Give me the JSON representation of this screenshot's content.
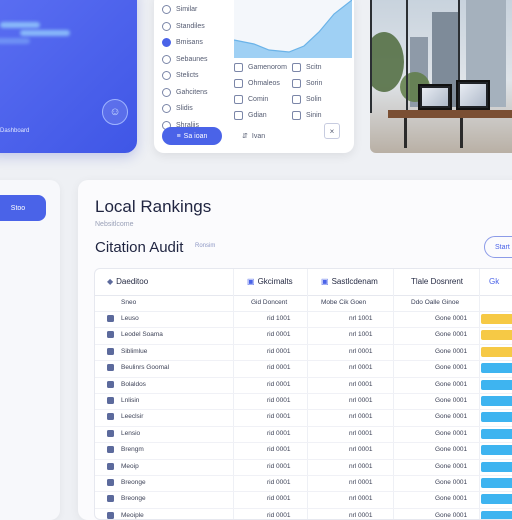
{
  "hero": {
    "label": "Dashboard",
    "avatar_icon": "user-icon"
  },
  "filters": {
    "items": [
      {
        "label": "Similar",
        "icon": "radio-icon"
      },
      {
        "label": "Standiles",
        "icon": "radio-icon"
      },
      {
        "label": "Bmisans",
        "icon": "location-icon"
      },
      {
        "label": "Sebaunes",
        "icon": "radio-icon"
      },
      {
        "label": "Stelicts",
        "icon": "radio-icon"
      },
      {
        "label": "Gahcitens",
        "icon": "radio-icon"
      },
      {
        "label": "Slidis",
        "icon": "radio-icon"
      },
      {
        "label": "Shraliis",
        "icon": "radio-icon"
      }
    ],
    "col2": [
      {
        "label": "Gamenorom",
        "icon": "checkbox-icon"
      },
      {
        "label": "Ohmaleos",
        "icon": "checkbox-icon"
      },
      {
        "label": "Comin",
        "icon": "checkbox-icon"
      },
      {
        "label": "Gdian",
        "icon": "checkbox-icon"
      }
    ],
    "col3": [
      {
        "label": "Scitn",
        "icon": "checkbox-icon"
      },
      {
        "label": "Sorin",
        "icon": "checkbox-icon"
      },
      {
        "label": "Solin",
        "icon": "checkbox-icon"
      },
      {
        "label": "Sinin",
        "icon": "radio-icon"
      }
    ],
    "apply_label": "Sa ioan",
    "aux_label": "Ivan",
    "aux_icon": "close-icon"
  },
  "side": {
    "button_label": "Stoo"
  },
  "page": {
    "title": "Local Rankings",
    "subtitle": "Nebsitlcome",
    "section_title": "Citation Audit",
    "section_tag": "Ronsim",
    "start_button": "Start"
  },
  "table": {
    "headers": [
      "Daeditoo",
      "Gkcimalts",
      "Sastlcdenam",
      "Tlale Dosnrent",
      "Gk"
    ],
    "subheaders": [
      "Sneo",
      "Gid Doncent",
      "Mobe Cik Goen",
      "Ddo Oalle Ginoe"
    ],
    "rows": [
      {
        "name": "Leuso",
        "v1": "rid 1001",
        "v2": "nrl 1001",
        "v3": "Gone 0001",
        "bar": "#f6c945"
      },
      {
        "name": "Leodel Soama",
        "v1": "rid 0001",
        "v2": "nrl 1001",
        "v3": "Gone 0001",
        "bar": "#f6c945"
      },
      {
        "name": "Siblimlue",
        "v1": "rid 0001",
        "v2": "nrl 0001",
        "v3": "Gone 0001",
        "bar": "#f6c945"
      },
      {
        "name": "Beulinrs Goomal",
        "v1": "rid 0001",
        "v2": "nrl 0001",
        "v3": "Gone 0001",
        "bar": "#3eb4f0"
      },
      {
        "name": "Bolaldos",
        "v1": "rid 0001",
        "v2": "nrl 0001",
        "v3": "Gone 0001",
        "bar": "#3eb4f0"
      },
      {
        "name": "Lnlisin",
        "v1": "rid 0001",
        "v2": "nrl 0001",
        "v3": "Gone 0001",
        "bar": "#3eb4f0"
      },
      {
        "name": "Leeclsir",
        "v1": "rid 0001",
        "v2": "nrl 0001",
        "v3": "Gone 0001",
        "bar": "#3eb4f0"
      },
      {
        "name": "Lensio",
        "v1": "rid 0001",
        "v2": "nrl 0001",
        "v3": "Gone 0001",
        "bar": "#3eb4f0"
      },
      {
        "name": "Brengm",
        "v1": "rid 0001",
        "v2": "nrl 0001",
        "v3": "Gone 0001",
        "bar": "#3eb4f0"
      },
      {
        "name": "Meoip",
        "v1": "rid 0001",
        "v2": "nrl 0001",
        "v3": "Gone 0001",
        "bar": "#3eb4f0"
      },
      {
        "name": "Breonge",
        "v1": "rid 0001",
        "v2": "nrl 0001",
        "v3": "Gone 0001",
        "bar": "#3eb4f0"
      },
      {
        "name": "Breonge",
        "v1": "rid 0001",
        "v2": "nrl 0001",
        "v3": "Gone 0001",
        "bar": "#3eb4f0"
      },
      {
        "name": "Meoiple",
        "v1": "rid 0001",
        "v2": "nrl 0001",
        "v3": "Gone 0001",
        "bar": "#3eb4f0"
      }
    ]
  },
  "colors": {
    "accent": "#4a63e8",
    "yellow": "#f6c945",
    "sky": "#3eb4f0"
  }
}
